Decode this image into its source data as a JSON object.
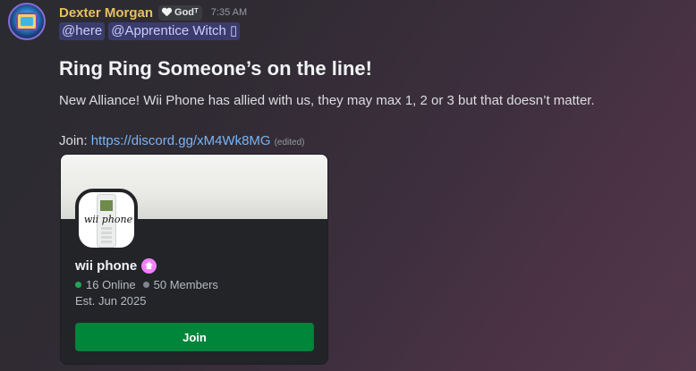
{
  "message": {
    "author": "Dexter Morgan",
    "tag": {
      "icon": "heart-icon",
      "label": "Godᵀ"
    },
    "timestamp": "7:35 AM",
    "mentions": [
      "@here",
      "@Apprentice Witch ▯"
    ],
    "title": "Ring Ring Someone’s on the line!",
    "body": "New Alliance! Wii Phone has allied with us, they may max 1, 2 or 3 but that doesn’t matter.",
    "join_label": "Join:",
    "join_link": "https://discord.gg/xM4Wk8MG",
    "edited": "(edited)"
  },
  "invite": {
    "icon_text": "wii phone",
    "server_name": "wii phone",
    "boost_icon": "boost-icon",
    "online": "16 Online",
    "members": "50 Members",
    "established": "Est. Jun 2025",
    "join_button": "Join"
  },
  "colors": {
    "username": "#e8c05c",
    "link": "#7ab4f5",
    "join_button": "#00863a",
    "online_dot": "#23a55a",
    "boost": "#f47fff"
  }
}
